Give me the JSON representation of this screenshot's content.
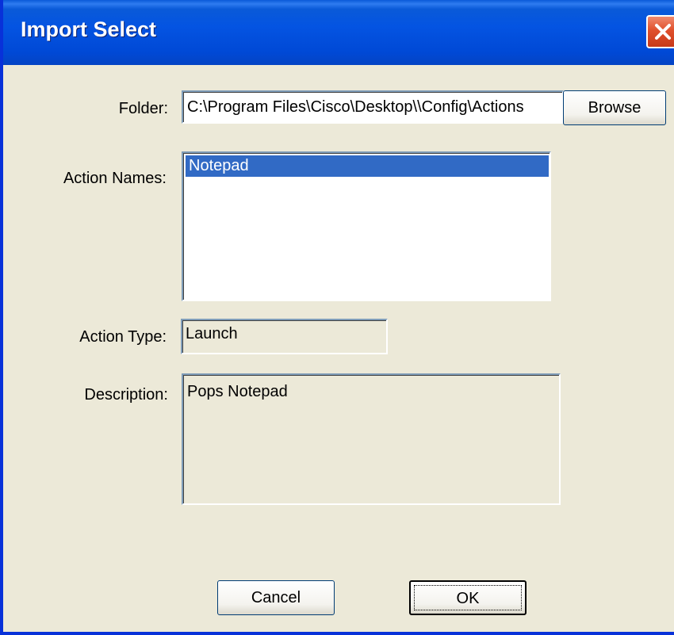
{
  "window": {
    "title": "Import Select"
  },
  "folder": {
    "label": "Folder:",
    "value": "C:\\Program Files\\Cisco\\Desktop\\\\Config\\Actions",
    "browse_label": "Browse"
  },
  "action_names": {
    "label": "Action Names:",
    "items": [
      {
        "label": "Notepad",
        "selected": true
      }
    ]
  },
  "action_type": {
    "label": "Action Type:",
    "value": "Launch"
  },
  "description": {
    "label": "Description:",
    "value": "Pops Notepad"
  },
  "buttons": {
    "cancel_label": "Cancel",
    "ok_label": "OK"
  },
  "icons": {
    "close": "close-icon"
  },
  "colors": {
    "titlebar": "#0454e2",
    "selection": "#316ac5",
    "dialog_bg": "#ece9d8",
    "close_button": "#e0502c"
  }
}
